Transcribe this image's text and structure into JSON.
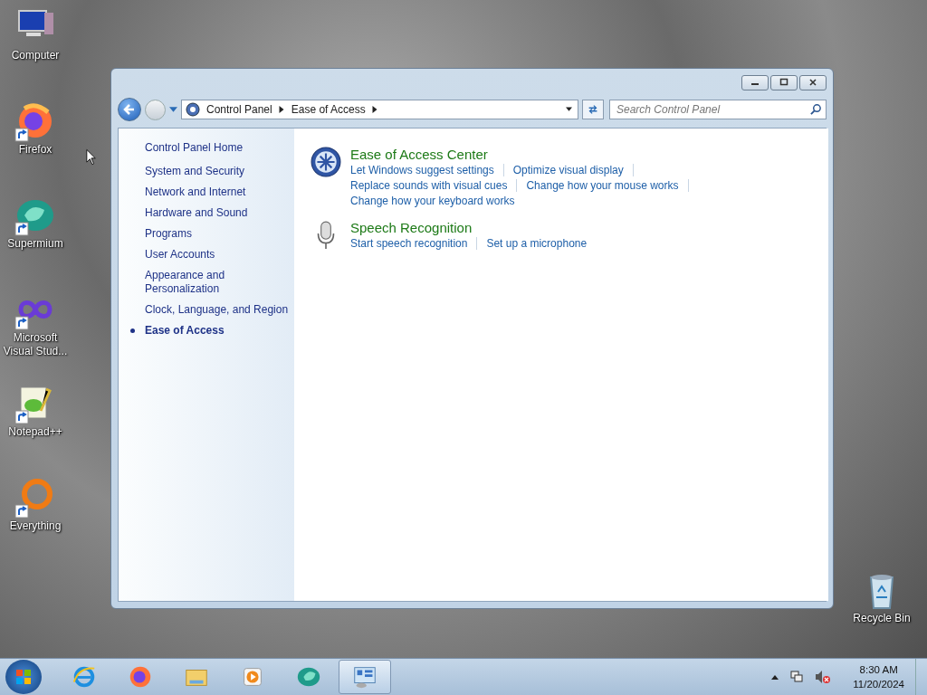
{
  "desktop_icons": [
    {
      "label": "Computer",
      "kind": "computer",
      "shortcut": false
    },
    {
      "label": "Firefox",
      "kind": "firefox",
      "shortcut": true
    },
    {
      "label": "Supermium",
      "kind": "supermium",
      "shortcut": true
    },
    {
      "label": "Microsoft Visual Stud...",
      "kind": "vs",
      "shortcut": true
    },
    {
      "label": "Notepad++",
      "kind": "notepad",
      "shortcut": true
    },
    {
      "label": "Everything",
      "kind": "everything",
      "shortcut": true
    }
  ],
  "recycle_bin": {
    "label": "Recycle Bin"
  },
  "window": {
    "breadcrumbs": [
      "Control Panel",
      "Ease of Access"
    ],
    "search": {
      "placeholder": "Search Control Panel"
    },
    "sidebar": {
      "home": "Control Panel Home",
      "items": [
        {
          "label": "System and Security",
          "selected": false
        },
        {
          "label": "Network and Internet",
          "selected": false
        },
        {
          "label": "Hardware and Sound",
          "selected": false
        },
        {
          "label": "Programs",
          "selected": false
        },
        {
          "label": "User Accounts",
          "selected": false
        },
        {
          "label": "Appearance and Personalization",
          "selected": false
        },
        {
          "label": "Clock, Language, and Region",
          "selected": false
        },
        {
          "label": "Ease of Access",
          "selected": true
        }
      ]
    },
    "categories": [
      {
        "title": "Ease of Access Center",
        "kind": "access",
        "links": [
          "Let Windows suggest settings",
          "Optimize visual display",
          "Replace sounds with visual cues",
          "Change how your mouse works",
          "Change how your keyboard works"
        ]
      },
      {
        "title": "Speech Recognition",
        "kind": "mic",
        "links": [
          "Start speech recognition",
          "Set up a microphone"
        ]
      }
    ]
  },
  "taskbar": {
    "items": [
      {
        "kind": "ie",
        "selected": false
      },
      {
        "kind": "firefox",
        "selected": false
      },
      {
        "kind": "explorer",
        "selected": false
      },
      {
        "kind": "media",
        "selected": false
      },
      {
        "kind": "supermium",
        "selected": false
      },
      {
        "kind": "controlpanel",
        "selected": true
      }
    ],
    "time": "8:30 AM",
    "date": "11/20/2024"
  }
}
